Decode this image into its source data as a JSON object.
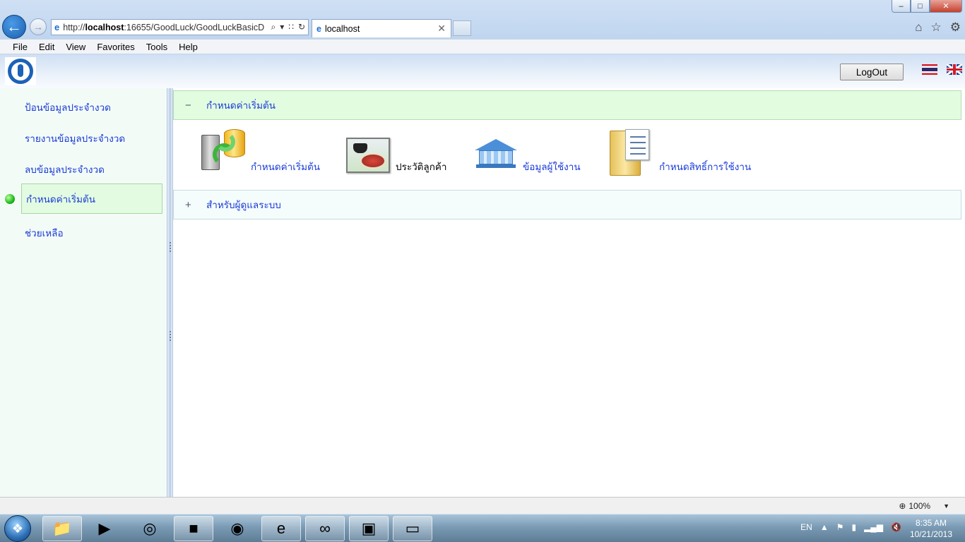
{
  "window": {
    "minimize": "–",
    "maximize": "□",
    "close": "✕"
  },
  "browser": {
    "back_glyph": "←",
    "forward_glyph": "→",
    "address": {
      "protocol": "http://",
      "host": "localhost",
      "path": ":16655/GoodLuck/GoodLuckBasicD"
    },
    "tab": {
      "title": "localhost",
      "close": "✕"
    },
    "toolbar_icons": [
      "home-icon",
      "favorites-star-icon",
      "settings-gear-icon"
    ]
  },
  "menubar": {
    "items": [
      "File",
      "Edit",
      "View",
      "Favorites",
      "Tools",
      "Help"
    ]
  },
  "header": {
    "logout_label": "LogOut",
    "flags": [
      "thai-flag-icon",
      "uk-flag-icon"
    ]
  },
  "sidebar": {
    "items": [
      {
        "label": "ป้อนข้อมูลประจำงวด",
        "active": false
      },
      {
        "label": "รายงานข้อมูลประจำงวด",
        "active": false
      },
      {
        "label": "ลบข้อมูลประจำงวด",
        "active": false
      },
      {
        "label": "กำหนดค่าเริ่มต้น",
        "active": true
      },
      {
        "label": "ช่วยเหลือ",
        "active": false
      }
    ]
  },
  "main": {
    "sections": [
      {
        "title": "กำหนดค่าเริ่มต้น",
        "toggle": "−",
        "expanded": true,
        "tiles": [
          {
            "label": "กำหนดค่าเริ่มต้น",
            "icon": "server-database-sync-icon"
          },
          {
            "label": "ประวัติลูกค้า",
            "icon": "customer-photo-icon"
          },
          {
            "label": "ข้อมูลผู้ใช้งาน",
            "icon": "bank-building-icon"
          },
          {
            "label": "กำหนดสิทธิ์การใช้งาน",
            "icon": "folder-document-icon"
          }
        ]
      },
      {
        "title": "สำหรับผู้ดูแลระบบ",
        "toggle": "+",
        "expanded": false
      }
    ]
  },
  "statusbar": {
    "zoom": "100%"
  },
  "taskbar": {
    "apps": [
      "file-explorer-icon",
      "media-player-icon",
      "chrome-icon",
      "command-prompt-icon",
      "firefox-icon",
      "internet-explorer-icon",
      "visual-studio-icon",
      "office-icon",
      "notepad-icon"
    ],
    "language": "EN",
    "time": "8:35 AM",
    "date": "10/21/2013"
  },
  "colors": {
    "link": "#1a3bd8",
    "active_green": "#e3fbe1",
    "accent_blue": "#1c62b7"
  }
}
